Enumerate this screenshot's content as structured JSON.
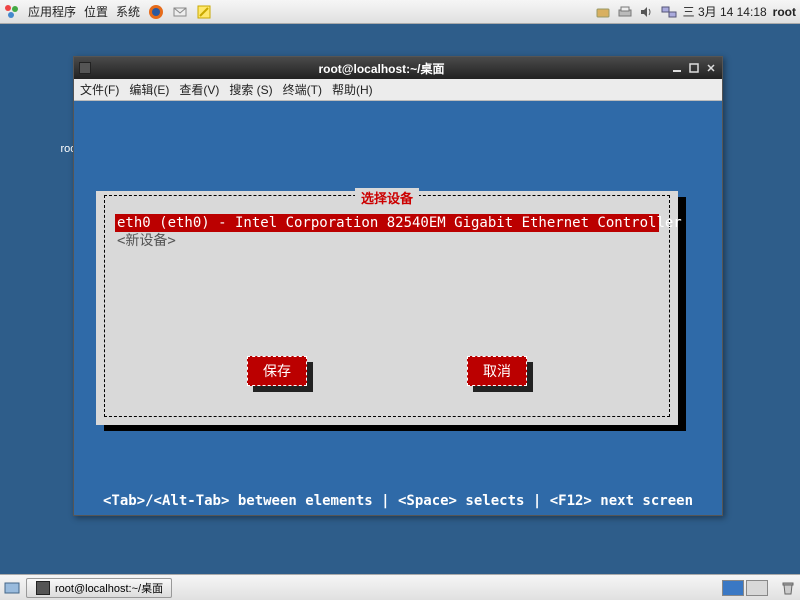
{
  "top_panel": {
    "menu_apps": "应用程序",
    "menu_places": "位置",
    "menu_system": "系统",
    "date": "三 3月 14 14:18",
    "user": "root"
  },
  "desktop": {
    "home_label": "root 的主文件夹"
  },
  "window": {
    "title": "root@localhost:~/桌面",
    "menubar": {
      "file": "文件(F)",
      "edit": "编辑(E)",
      "view": "查看(V)",
      "search": "搜索 (S)",
      "terminal": "终端(T)",
      "help": "帮助(H)"
    }
  },
  "tui": {
    "dialog_title": "选择设备",
    "item_selected": "eth0 (eth0) - Intel Corporation 82540EM Gigabit Ethernet Controller",
    "item_new": "<新设备>",
    "btn_save": "保存",
    "btn_cancel": "取消",
    "hint": "<Tab>/<Alt-Tab> between elements   |   <Space> selects   |  <F12> next screen"
  },
  "taskbar": {
    "task1": "root@localhost:~/桌面"
  }
}
